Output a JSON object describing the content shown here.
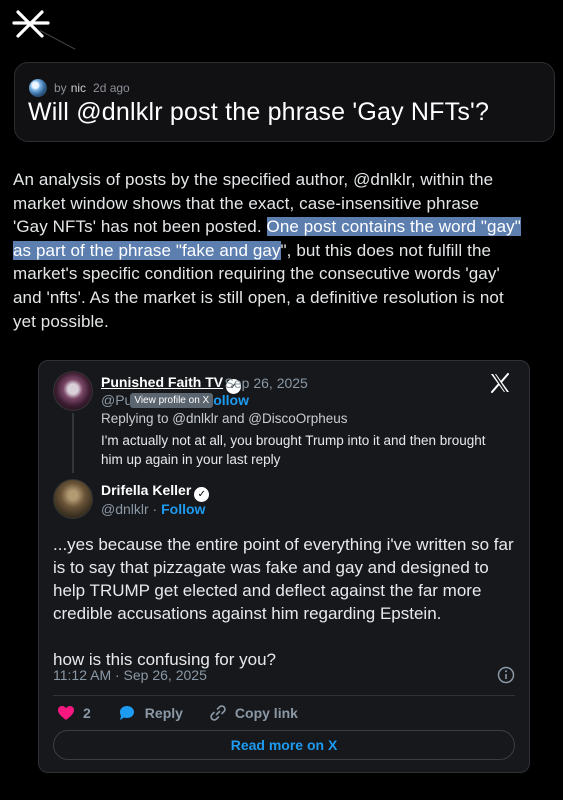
{
  "question": {
    "avatar": "globe-avatar",
    "by_prefix": "by",
    "author": "nic",
    "age": "2d ago",
    "title": "Will @dnlklr post the phrase 'Gay NFTs'?"
  },
  "analysis": {
    "lines": [
      "An analysis of posts by the specified author, @dnlklr, within the",
      "market window shows that the exact, case-insensitive phrase",
      "'Gay NFTs' has not been posted. ",
      "One post contains the word \"gay\"",
      "as part of the phrase \"fake and gay",
      "\", but this does not fulfill the",
      "market's specific condition requiring the consecutive words 'gay'",
      "and 'nfts'. As the market is still open, a definitive resolution is not",
      "yet possible."
    ]
  },
  "embed": {
    "reply": {
      "author": "Punished Faith TV",
      "date": "· Sep 26, 2025",
      "handle_partial": "@Pu",
      "tooltip": "View profile on X",
      "follow_partial": "ollow",
      "replying_to": "Replying to @dnlklr and @DiscoOrpheus",
      "text": "I'm actually not at all, you brought Trump into it and then brought him up again in your last reply"
    },
    "main": {
      "author": "Drifella Keller",
      "handle": "@dnlklr · ",
      "follow": "Follow",
      "paragraph1": "...yes because the entire point of everything i've written so far is to say that pizzagate was fake and gay and designed to help TRUMP get elected and deflect against the far more credible accusations against him regarding Epstein.",
      "paragraph2": "how is this confusing for you?",
      "timestamp": "11:12 AM · Sep 26, 2025"
    },
    "actions": {
      "likes": "2",
      "reply": "Reply",
      "copy_link": "Copy link"
    },
    "read_more": "Read more on X"
  },
  "colors": {
    "accent": "#1d9bf0",
    "highlight": "#5d7fb0",
    "like": "#f91880"
  }
}
